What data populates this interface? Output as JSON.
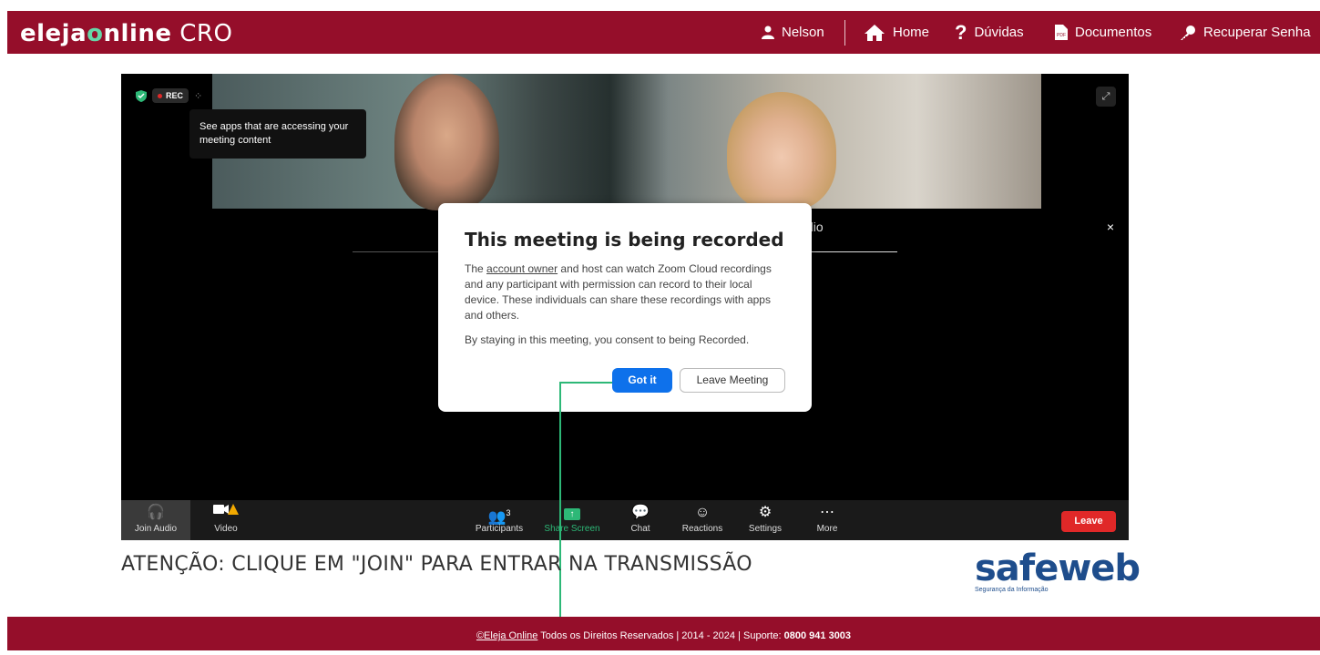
{
  "header": {
    "logo_bold": "eleja",
    "logo_o": "o",
    "logo_rest": "nline",
    "logo_suffix": "CRO",
    "user": "Nelson",
    "home": "Home",
    "duvidas": "Dúvidas",
    "documentos": "Documentos",
    "recuperar": "Recuperar Senha"
  },
  "video": {
    "rec_label": "REC",
    "tooltip": "See apps that are accessing your meeting content",
    "behind_text": "dio",
    "close": "×"
  },
  "modal": {
    "title": "This meeting is being recorded",
    "p1_pre": "The ",
    "p1_link": "account owner",
    "p1_post": " and host can watch Zoom Cloud recordings and any participant with permission can record to their local device. These individuals can share these recordings with apps and others.",
    "p2": "By staying in this meeting, you consent to being Recorded.",
    "got_it": "Got it",
    "leave_meeting": "Leave Meeting"
  },
  "toolbar": {
    "join_audio": "Join Audio",
    "video": "Video",
    "participants": "Participants",
    "participants_count": "3",
    "share_screen": "Share Screen",
    "chat": "Chat",
    "reactions": "Reactions",
    "settings": "Settings",
    "more": "More",
    "leave": "Leave"
  },
  "attention": "ATENÇÃO: CLIQUE EM \"JOIN\" PARA ENTRAR NA TRANSMISSÃO",
  "safeweb": {
    "name": "safeweb",
    "tagline": "Segurança da Informação"
  },
  "footer": {
    "link": "©Eleja Online",
    "text": " Todos os Direitos Reservados  |  2014 - 2024 | Suporte: ",
    "phone": "0800 941 3003"
  },
  "colors": {
    "brand": "#950e2a",
    "zoom_blue": "#0e71eb",
    "leave_red": "#e02828",
    "safeweb_blue": "#1e4d8c"
  }
}
